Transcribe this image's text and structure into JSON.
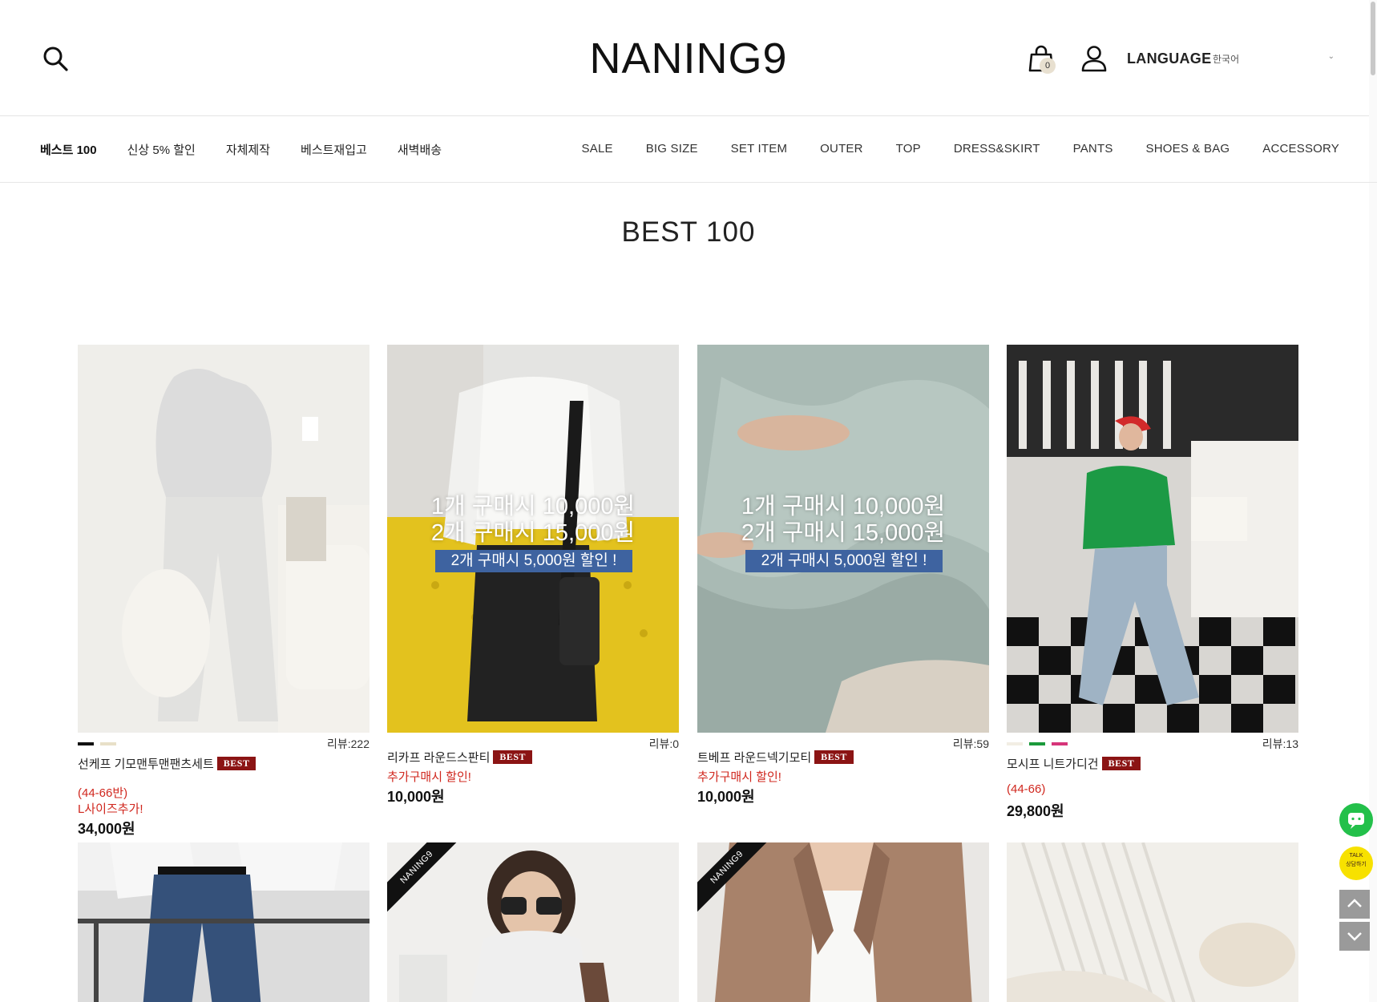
{
  "header": {
    "logo": "NANING9",
    "cart_count": "0",
    "language_label": "LANGUAGE",
    "language_value": "한국어"
  },
  "nav": {
    "left": [
      "베스트 100",
      "신상 5% 할인",
      "자체제작",
      "베스트재입고",
      "새벽배송"
    ],
    "right": [
      "SALE",
      "BIG SIZE",
      "SET ITEM",
      "OUTER",
      "TOP",
      "DRESS&SKIRT",
      "PANTS",
      "SHOES & BAG",
      "ACCESSORY"
    ]
  },
  "page_title": "BEST 100",
  "badge_label": "BEST",
  "products": [
    {
      "name": "선케프 기모맨투맨팬츠세트",
      "review": "리뷰:222",
      "notes": [
        "(44-66반)",
        "L사이즈추가!"
      ],
      "price": "34,000원",
      "swatches": [
        "#111111",
        "#e8e0c8"
      ]
    },
    {
      "name": "리카프 라운드스판티",
      "review": "리뷰:0",
      "notes": [
        "추가구매시 할인!"
      ],
      "price": "10,000원",
      "overlay": {
        "line1": "1개 구매시 10,000원",
        "line2": "2개 구매시 15,000원",
        "pill": "2개 구매시 5,000원 할인 !"
      }
    },
    {
      "name": "트베프 라운드넥기모티",
      "review": "리뷰:59",
      "notes": [
        "추가구매시 할인!"
      ],
      "price": "10,000원",
      "overlay": {
        "line1": "1개 구매시 10,000원",
        "line2": "2개 구매시 15,000원",
        "pill": "2개 구매시 5,000원 할인 !"
      }
    },
    {
      "name": "모시프 니트가디건",
      "review": "리뷰:13",
      "notes": [
        "(44-66)"
      ],
      "price": "29,800원",
      "swatches": [
        "#f2eee4",
        "#1b9a3b",
        "#d6357a"
      ]
    }
  ],
  "row2_tags": [
    "NANING9",
    "NANING9"
  ],
  "floating": {
    "kakao_label": "상담하기",
    "kakao_top": "TALK"
  }
}
